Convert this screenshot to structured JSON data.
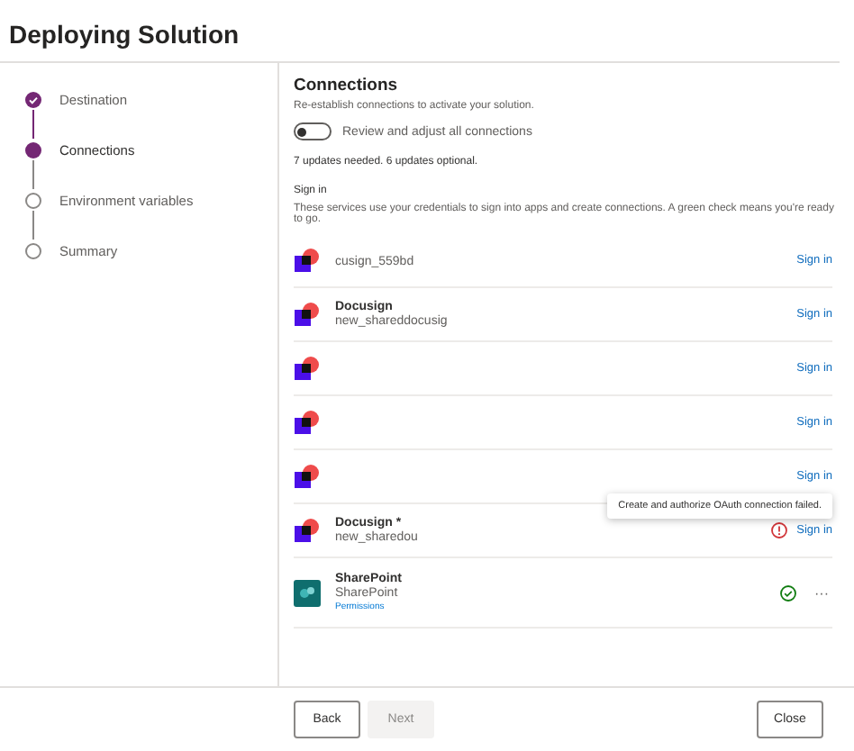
{
  "window": {
    "title": "Deploying Solution"
  },
  "steps": [
    {
      "label": "Destination",
      "completed": true,
      "selected": false
    },
    {
      "label": "Connections",
      "completed": false,
      "selected": true
    },
    {
      "label": "Environment variables",
      "completed": false,
      "selected": false
    },
    {
      "label": "Summary",
      "completed": false,
      "selected": false
    }
  ],
  "connections_section": {
    "title": "Connections",
    "subtitle": "Re-establish connections to activate your solution.",
    "toggle": {
      "label": "Review and adjust all connections",
      "on": false
    },
    "summary": "7 updates needed. 6 updates optional.",
    "sign_in_heading": "Sign in",
    "sign_in_description": "These services use your credentials to sign into apps and create connections. A green check means you're ready to go.",
    "rows": [
      {
        "kind": "docusign",
        "connection": "cusign_559bd",
        "error": false,
        "connected": false,
        "action": "Sign in"
      },
      {
        "kind": "docusign",
        "name": "Docusign",
        "connection": "new_shareddocusig",
        "error": false,
        "connected": false,
        "action": "Sign in"
      },
      {
        "kind": "docusign",
        "error": false,
        "connected": false,
        "action": "Sign in"
      },
      {
        "kind": "docusign",
        "error": false,
        "connected": false,
        "action": "Sign in"
      },
      {
        "kind": "docusign",
        "error": false,
        "connected": false,
        "action": "Sign in"
      },
      {
        "kind": "docusign",
        "name": "Docusign *",
        "connection": "new_sharedou",
        "error": true,
        "connected": false,
        "action": "Sign in",
        "tooltip": "Create and authorize OAuth connection failed."
      },
      {
        "kind": "sharepoint",
        "name": "SharePoint",
        "connection": "SharePoint",
        "link": "Permissions",
        "error": false,
        "connected": true,
        "more": "···"
      }
    ]
  },
  "footer": {
    "back": {
      "label": "Back",
      "disabled": false
    },
    "next": {
      "label": "Next",
      "disabled": true
    },
    "close": {
      "label": "Close",
      "disabled": false
    }
  }
}
